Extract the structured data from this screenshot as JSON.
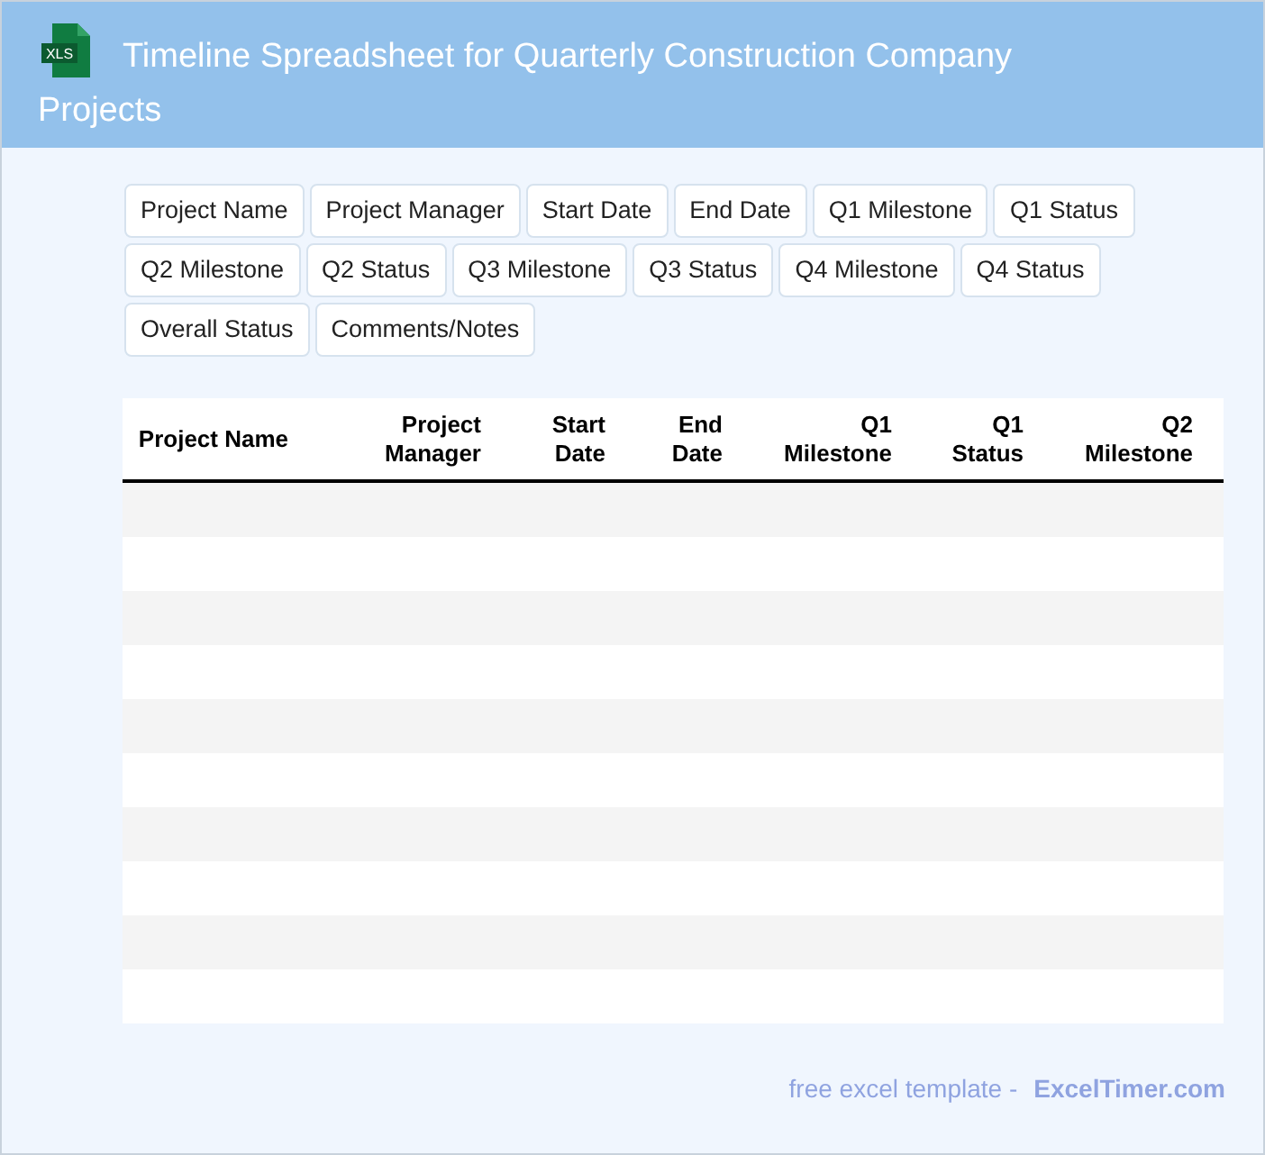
{
  "header": {
    "icon_label": "XLS",
    "title_lines": [
      "Timeline Spreadsheet for Quarterly Construction Company",
      "Projects"
    ]
  },
  "field_chips": [
    "Project Name",
    "Project Manager",
    "Start Date",
    "End Date",
    "Q1 Milestone",
    "Q1 Status",
    "Q2 Milestone",
    "Q2 Status",
    "Q3 Milestone",
    "Q3 Status",
    "Q4 Milestone",
    "Q4 Status",
    "Overall Status",
    "Comments/Notes"
  ],
  "table": {
    "columns": [
      "Project Name",
      "Project Manager",
      "Start Date",
      "End Date",
      "Q1 Milestone",
      "Q1 Status",
      "Q2 Milestone"
    ]
  },
  "footer": {
    "text": "free excel template -",
    "link": "ExcelTimer.com"
  }
}
